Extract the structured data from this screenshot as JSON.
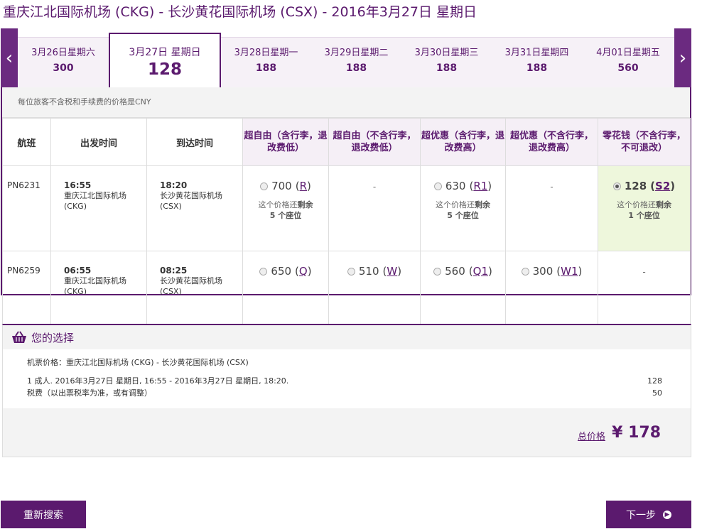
{
  "title": "重庆江北国际机场 (CKG) - 长沙黄花国际机场 (CSX) - 2016年3月27日 星期日",
  "dates": [
    {
      "label": "3月26日星期六",
      "price": "300"
    },
    {
      "label": "3月27日 星期日",
      "price": "128"
    },
    {
      "label": "3月28日星期一",
      "price": "188"
    },
    {
      "label": "3月29日星期二",
      "price": "188"
    },
    {
      "label": "3月30日星期三",
      "price": "188"
    },
    {
      "label": "3月31日星期四",
      "price": "188"
    },
    {
      "label": "4月01日星期五",
      "price": "560"
    }
  ],
  "nav": {
    "prev": "‹",
    "next": "›"
  },
  "note": "每位旅客不含税和手续费的价格是CNY",
  "headers": {
    "flight": "航班",
    "depart": "出发时间",
    "arrive": "到达时间",
    "fares": [
      "超自由（含行李，退改费低）",
      "超自由（不含行李，退改费低）",
      "超优惠（含行李，退改费高）",
      "超优惠（不含行李，退改费高）",
      "零花钱（不含行李，不可退改）"
    ]
  },
  "flights": [
    {
      "no": "PN6231",
      "dep_time": "16:55",
      "dep_airport": "重庆江北国际机场",
      "dep_code": "(CKG)",
      "arr_time": "18:20",
      "arr_airport": "长沙黄花国际机场",
      "arr_code": "(CSX)",
      "fares": [
        {
          "price": "700",
          "code": "R",
          "seats_l1": "这个价格还",
          "seats_b": "剩余",
          "seats_l2": "5 个座位"
        },
        {
          "dash": "-"
        },
        {
          "price": "630",
          "code": "R1",
          "seats_l1": "这个价格还",
          "seats_b": "剩余",
          "seats_l2": "5 个座位"
        },
        {
          "dash": "-"
        },
        {
          "price": "128",
          "code": "S2",
          "seats_l1": "这个价格还",
          "seats_b": "剩余",
          "seats_l2": "1 个座位"
        }
      ]
    },
    {
      "no": "PN6259",
      "dep_time": "06:55",
      "dep_airport": "重庆江北国际机场",
      "dep_code": "(CKG)",
      "arr_time": "08:25",
      "arr_airport": "长沙黄花国际机场",
      "arr_code": "(CSX)",
      "fares": [
        {
          "price": "650",
          "code": "Q"
        },
        {
          "price": "510",
          "code": "W"
        },
        {
          "price": "560",
          "code": "Q1"
        },
        {
          "price": "300",
          "code": "W1"
        },
        {
          "dash": "-"
        }
      ]
    }
  ],
  "choice": {
    "heading": "您的选择",
    "route": "机票价格：重庆江北国际机场 (CKG) - 长沙黄花国际机场 (CSX)",
    "fare_line": "1 成人. 2016年3月27日 星期日, 16:55 - 2016年3月27日 星期日, 18:20.",
    "fare_amount": "128",
    "tax_line": "税费（以出票税率为准，或有调整）",
    "tax_amount": "50",
    "total_label": "总价格",
    "total_value": "¥ 178"
  },
  "buttons": {
    "back": "重新搜索",
    "next": "下一步"
  },
  "colors": {
    "accent": "#5b1a6e",
    "selected_bg": "#eef7dc"
  }
}
